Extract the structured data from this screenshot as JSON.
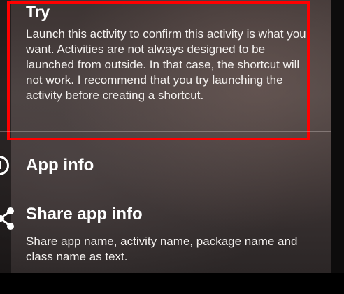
{
  "menu": {
    "try": {
      "title": "Try",
      "description": "Launch this activity to confirm this activity is what you want. Activities are not always designed to be launched from outside. In that case, the shortcut will not work. I recommend that you try launching the activity before creating a shortcut."
    },
    "app_info": {
      "label": "App info",
      "icon": "info-icon"
    },
    "share_app_info": {
      "label": "Share app info",
      "description": "Share app name, activity name, package name and class name as text.",
      "icon": "share-icon"
    }
  },
  "highlight": {
    "color": "#ff0000"
  }
}
